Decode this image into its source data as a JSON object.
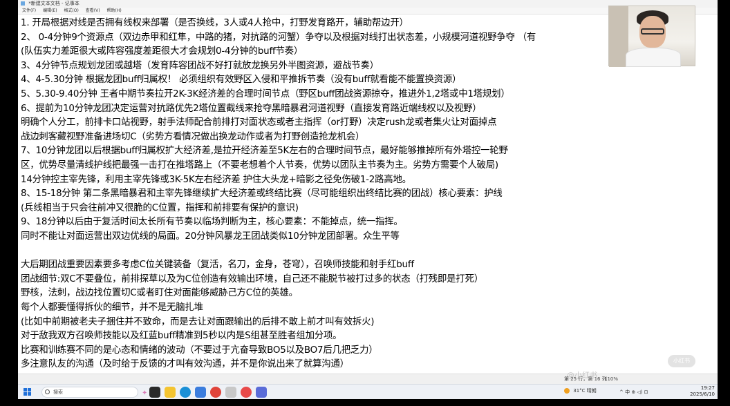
{
  "window": {
    "title": "*新建文本文档 - 记事本",
    "menu": [
      "文件(F)",
      "编辑(E)",
      "格式(O)",
      "查看(V)",
      "帮助(H)"
    ]
  },
  "document": {
    "lines": [
      "1.    开局根据对线是否拥有线权来部署（是否换线，3人或4人抢中，打野发育路开，辅助帮边开）",
      "2、 0-4分钟9个资源点（双边赤甲和红隼，中路的猪，对抗路的河蟹）争夺以及根据对线打出状态差，小规模河道视野争夺  （有",
      "      (队伍实力差距很大或阵容强度差距很大才会规划0-4分钟的buff节奏）",
      "3、4分钟节点规划龙团或越塔（发育阵容团战不好打就放龙换另外半图资源，避战节奏）",
      "4、4-5.30分钟 根据龙团buff归属权！ 必须组织有效野区入侵和平推拆节奏（没有buff就看能不能置换资源）",
      "5、5.30-9.40分钟 王者中期节奏拉开2K-3K经济差的合理时间节点（野区buff团战资源掠夺，推进外1,2塔或中1塔规划）",
      "6、提前为10分钟龙团决定运营对抗路优先2塔位置截线来抢夺黑暗暴君河道视野（直接发育路近端线权以及视野）",
      "      明确个人分工，前排卡口站视野，射手法师配合前排打对面状态或者主指挥（or打野）决定rush龙或者集火让对面掉点",
      "      战边刺客藏视野准备进场切C（劣势方看情况做出换龙动作或者为打野创造抢龙机会）",
      "7、10分钟龙团以后根据buff归属权扩大经济差,是拉开经济差至5K左右的合理时间节点，最好能够推掉所有外塔控一轮野",
      "      区，优势尽量清线护线把最强一击打在推塔路上（不要老想着个人节奏，优势以团队主节奏为主。劣势方需要个人破局)",
      "      14分钟控主宰先锋，利用主宰先锋或3K-5K左右经济差 护住大头龙+暗影之径免伤破1-2路高地。",
      "8、15-18分钟 第二条黑暗暴君和主宰先锋继续扩大经济差或终结比赛（尽可能组织出终结比赛的团战）核心要素：护线",
      "      (兵线相当于只会往前冲又很脆的C位置，指挥和前排要有保护的意识)",
      "9、18分钟以后由于复活时间太长所有节奏以临场判断为主，核心要素：不能掉点，统一指挥。",
      "      同时不能让对面运营出双边优线的局面。20分钟风暴龙王团战类似10分钟龙团部署。众生平等",
      "",
      "      大后期团战重要因素要多考虑C位关键装备（复活，名刀，金身，苍穹），召唤师技能和射手红buff",
      "      团战细节:双C不要叠位，前排探草以及为C位创造有效输出环境，自己还不能脱节被打过多的状态（打残即是打死）",
      "      野核，法刺，战边找位置切C或者盯住对面能够威胁己方C位的英雄。",
      "      每个人都要懂得拆伙的细节，并不是无脑扎堆",
      "      (比如中前期被老夫子捆住并不致命，而是去让对面跟输出的后排不敢上前才叫有效拆火)",
      "      对于敌我双方召唤师技能以及红蓝buff精准到5秒以内是S组甚至胜者组加分项。",
      "      比赛和训练赛不同的是心态和情绪的波动（不要过于亢奋导致BO5以及BO7后几把乏力）",
      "      多注意队友的沟通（及时给于反馈的才叫有效沟通，并不是你说出来了就算沟通）"
    ]
  },
  "statusbar": {
    "position": "第 25 行，第 16 列",
    "zoom": "110%"
  },
  "watermark": {
    "text": "@小红书",
    "badge": "小红书"
  },
  "taskbar": {
    "search_placeholder": "搜索",
    "weather": "31°C 晴朗",
    "tray": "^  中  ⊕  ◁)  ⊡",
    "time": "19:27",
    "date": "2025/6/10"
  }
}
